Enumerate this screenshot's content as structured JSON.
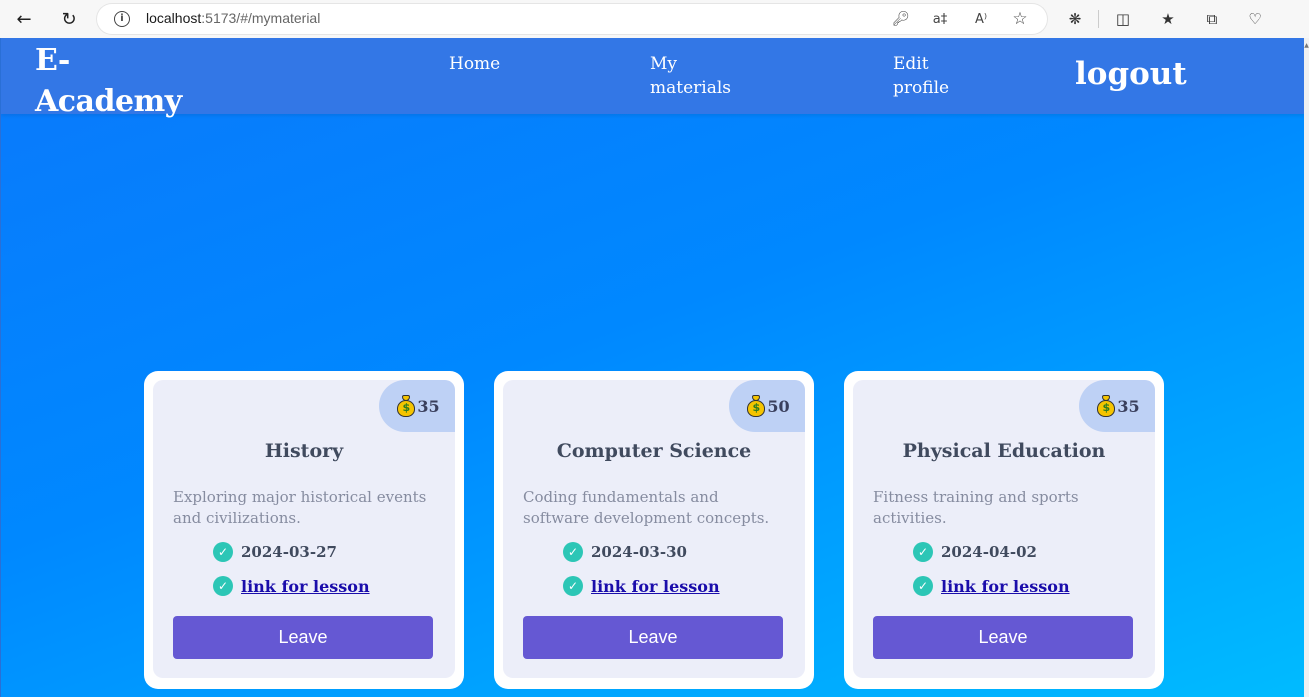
{
  "browser": {
    "back_icon": "back-arrow-icon",
    "reload_icon": "reload-icon",
    "url_host": "localhost",
    "url_path": ":5173/#/mymaterial"
  },
  "navbar": {
    "brand": "E-Academy",
    "links": {
      "home": "Home",
      "my_materials": "My materials",
      "edit_profile": "Edit profile",
      "logout": "logout"
    }
  },
  "materials": [
    {
      "price": "35",
      "title": "History",
      "description": "Exploring major historical events and civilizations.",
      "date": "2024-03-27",
      "link_label": "link for lesson",
      "button_label": "Leave"
    },
    {
      "price": "50",
      "title": "Computer Science",
      "description": "Coding fundamentals and software development concepts.",
      "date": "2024-03-30",
      "link_label": "link for lesson",
      "button_label": "Leave"
    },
    {
      "price": "35",
      "title": "Physical Education",
      "description": "Fitness training and sports activities.",
      "date": "2024-04-02",
      "link_label": "link for lesson",
      "button_label": "Leave"
    }
  ],
  "colors": {
    "navbar": "#3377e6",
    "page_gradient_start": "#0a79fb",
    "page_gradient_end": "#00bbff",
    "card_inner": "#eceef9",
    "price_tag": "#bed1f5",
    "check": "#2cc6b6",
    "button": "#6558d3",
    "link": "#1a0dab"
  }
}
